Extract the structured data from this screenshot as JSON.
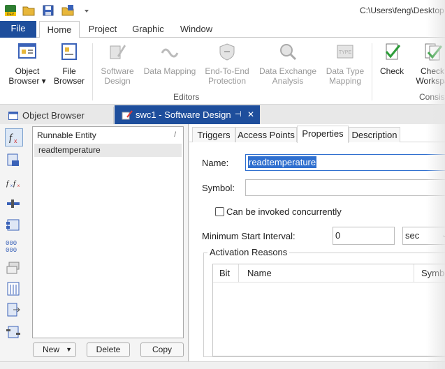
{
  "titlebar": {
    "path": "C:\\Users\\feng\\Desktop"
  },
  "quick_access": [
    "app-logo-icon",
    "open-folder-icon",
    "save-icon",
    "save-folder-icon",
    "customize-dropdown-icon"
  ],
  "ribbon_tabs": {
    "file": "File",
    "home": "Home",
    "project": "Project",
    "graphic": "Graphic",
    "window": "Window",
    "active": "Home"
  },
  "ribbon": {
    "object_browser": {
      "line1": "Object",
      "line2": "Browser ▾"
    },
    "file_browser": {
      "line1": "File",
      "line2": "Browser"
    },
    "software_design": {
      "line1": "Software",
      "line2": "Design"
    },
    "data_mapping": {
      "line1": "Data Mapping",
      "line2": ""
    },
    "e2e_protection": {
      "line1": "End-To-End",
      "line2": "Protection"
    },
    "data_exchange": {
      "line1": "Data Exchange",
      "line2": "Analysis"
    },
    "data_type_mapping": {
      "line1": "Data Type",
      "line2": "Mapping"
    },
    "check": {
      "line1": "Check",
      "line2": ""
    },
    "check_workspace": {
      "line1": "Check",
      "line2": "Workspa"
    },
    "editors_group": "Editors",
    "consistency_group": "Consist"
  },
  "doc_tabs": {
    "object_browser": "Object Browser",
    "software_design": "swc1 - Software Design",
    "pin_glyph": "⊣",
    "close_glyph": "✕"
  },
  "left_panel": {
    "tools": [
      "function-icon",
      "lock-entity-icon",
      "function-compose-icon",
      "slider-icon",
      "component-icon",
      "ports-icon",
      "layers-icon",
      "data-table-icon",
      "export-icon",
      "runnable-tree-icon"
    ],
    "list_header": "Runnable Entity",
    "sort_mark": "/",
    "items": [
      "readtemperature"
    ],
    "buttons": {
      "new": "New",
      "delete": "Delete",
      "copy": "Copy"
    }
  },
  "properties": {
    "tabs": {
      "triggers": "Triggers",
      "access_points": "Access Points",
      "properties": "Properties",
      "description": "Description",
      "active": "Properties"
    },
    "name_label": "Name:",
    "name_value": "readtemperature",
    "symbol_label": "Symbol:",
    "symbol_value": "",
    "concurrent_label": "Can be invoked concurrently",
    "concurrent_checked": false,
    "min_interval_label": "Minimum Start Interval:",
    "min_interval_value": "0",
    "min_interval_unit": "sec",
    "activation_group": "Activation Reasons",
    "activation_columns": {
      "bit": "Bit",
      "name": "Name",
      "symbol": "Symbo"
    }
  },
  "colors": {
    "accent": "#1e4e9c",
    "selection": "#2f6fcf"
  }
}
